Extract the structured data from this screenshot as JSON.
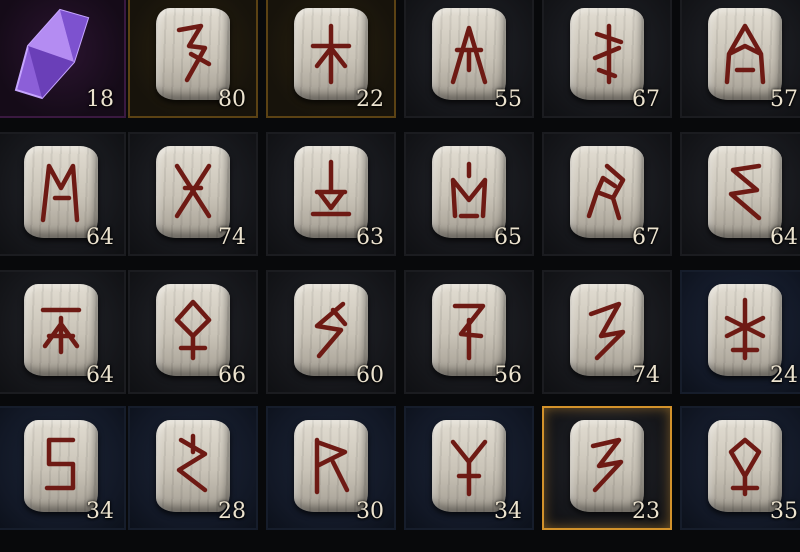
{
  "inventory": {
    "items": [
      {
        "kind": "gem",
        "name": "amethyst-crystal-icon",
        "count": "18",
        "style": "purple"
      },
      {
        "kind": "rune",
        "name": "rune-icon",
        "count": "80",
        "style": "gold",
        "glyph": 0
      },
      {
        "kind": "rune",
        "name": "rune-icon",
        "count": "22",
        "style": "gold",
        "glyph": 1
      },
      {
        "kind": "rune",
        "name": "rune-icon",
        "count": "55",
        "style": "",
        "glyph": 2
      },
      {
        "kind": "rune",
        "name": "rune-icon",
        "count": "67",
        "style": "",
        "glyph": 3
      },
      {
        "kind": "rune",
        "name": "rune-icon",
        "count": "57",
        "style": "",
        "glyph": 4
      },
      {
        "kind": "rune",
        "name": "rune-icon",
        "count": "64",
        "style": "",
        "glyph": 5
      },
      {
        "kind": "rune",
        "name": "rune-icon",
        "count": "74",
        "style": "",
        "glyph": 6
      },
      {
        "kind": "rune",
        "name": "rune-icon",
        "count": "63",
        "style": "",
        "glyph": 7
      },
      {
        "kind": "rune",
        "name": "rune-icon",
        "count": "65",
        "style": "",
        "glyph": 8
      },
      {
        "kind": "rune",
        "name": "rune-icon",
        "count": "67",
        "style": "",
        "glyph": 9
      },
      {
        "kind": "rune",
        "name": "rune-icon",
        "count": "64",
        "style": "",
        "glyph": 10
      },
      {
        "kind": "rune",
        "name": "rune-icon",
        "count": "64",
        "style": "",
        "glyph": 11
      },
      {
        "kind": "rune",
        "name": "rune-icon",
        "count": "66",
        "style": "",
        "glyph": 12
      },
      {
        "kind": "rune",
        "name": "rune-icon",
        "count": "60",
        "style": "",
        "glyph": 13
      },
      {
        "kind": "rune",
        "name": "rune-icon",
        "count": "56",
        "style": "",
        "glyph": 14
      },
      {
        "kind": "rune",
        "name": "rune-icon",
        "count": "74",
        "style": "",
        "glyph": 15
      },
      {
        "kind": "rune",
        "name": "rune-icon",
        "count": "24",
        "style": "blue",
        "glyph": 16
      },
      {
        "kind": "rune",
        "name": "rune-icon",
        "count": "34",
        "style": "blue",
        "glyph": 17
      },
      {
        "kind": "rune",
        "name": "rune-icon",
        "count": "28",
        "style": "blue",
        "glyph": 18
      },
      {
        "kind": "rune",
        "name": "rune-icon",
        "count": "30",
        "style": "blue",
        "glyph": 19
      },
      {
        "kind": "rune",
        "name": "rune-icon",
        "count": "34",
        "style": "blue",
        "glyph": 20
      },
      {
        "kind": "rune",
        "name": "rune-icon",
        "count": "23",
        "style": "selected",
        "glyph": 21
      },
      {
        "kind": "rune",
        "name": "rune-icon",
        "count": "35",
        "style": "blue",
        "glyph": 22
      }
    ]
  },
  "colors": {
    "rune_carving": "#6e1a14",
    "count_text": "#ece3cf",
    "selected_border": "#d3922b"
  }
}
